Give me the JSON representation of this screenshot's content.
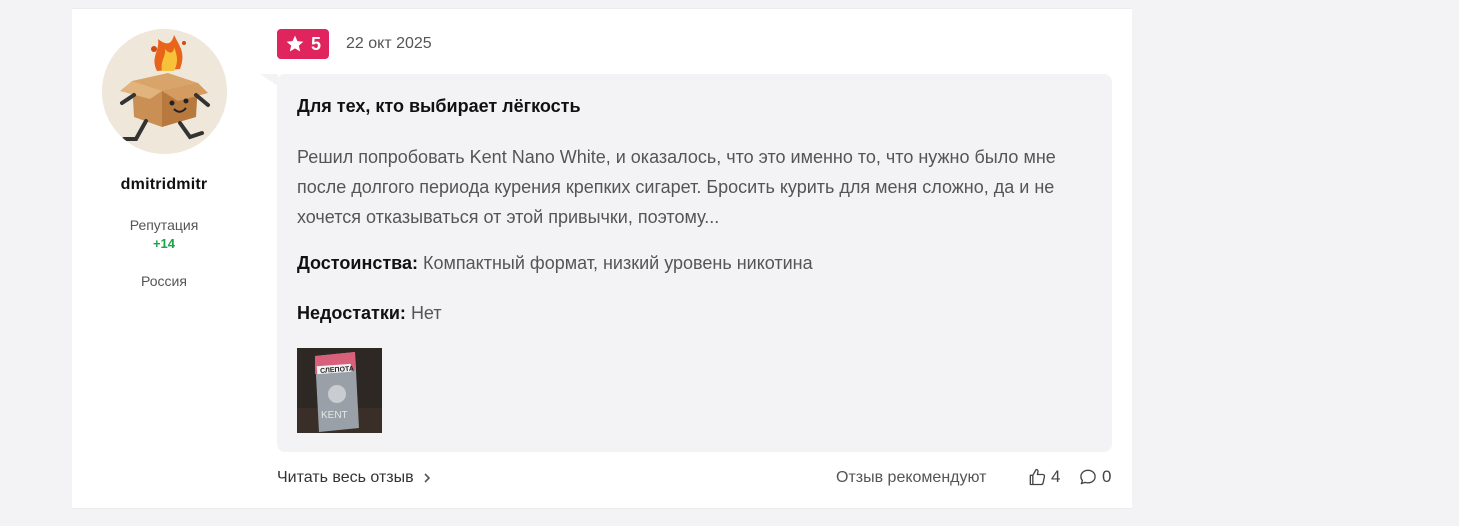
{
  "user": {
    "username": "dmitridmitr",
    "reputation_label": "Репутация",
    "reputation_value": "+14",
    "country": "Россия"
  },
  "review": {
    "rating": "5",
    "date": "22 окт 2025",
    "title": "Для тех, кто выбирает лёгкость",
    "text": "Решил попробовать Kent Nano White, и оказалось, что это именно то, что нужно было мне после долгого периода курения крепких сигарет. Бросить курить для меня сложно, да и не хочется отказываться от этой привычки, поэтому...",
    "pros_label": "Достоинства:",
    "pros": "Компактный формат, низкий уровень никотина",
    "cons_label": "Недостатки:",
    "cons": "Нет",
    "photo_label_top": "СЛЕПОТА",
    "photo_label_brand": "KENT"
  },
  "footer": {
    "read_more": "Читать весь отзыв",
    "recommend_label": "Отзыв рекомендуют",
    "likes": "4",
    "comments": "0"
  },
  "colors": {
    "rating_badge": "#e0245e",
    "reputation": "#1aa44b",
    "bubble": "#f3f3f5"
  }
}
